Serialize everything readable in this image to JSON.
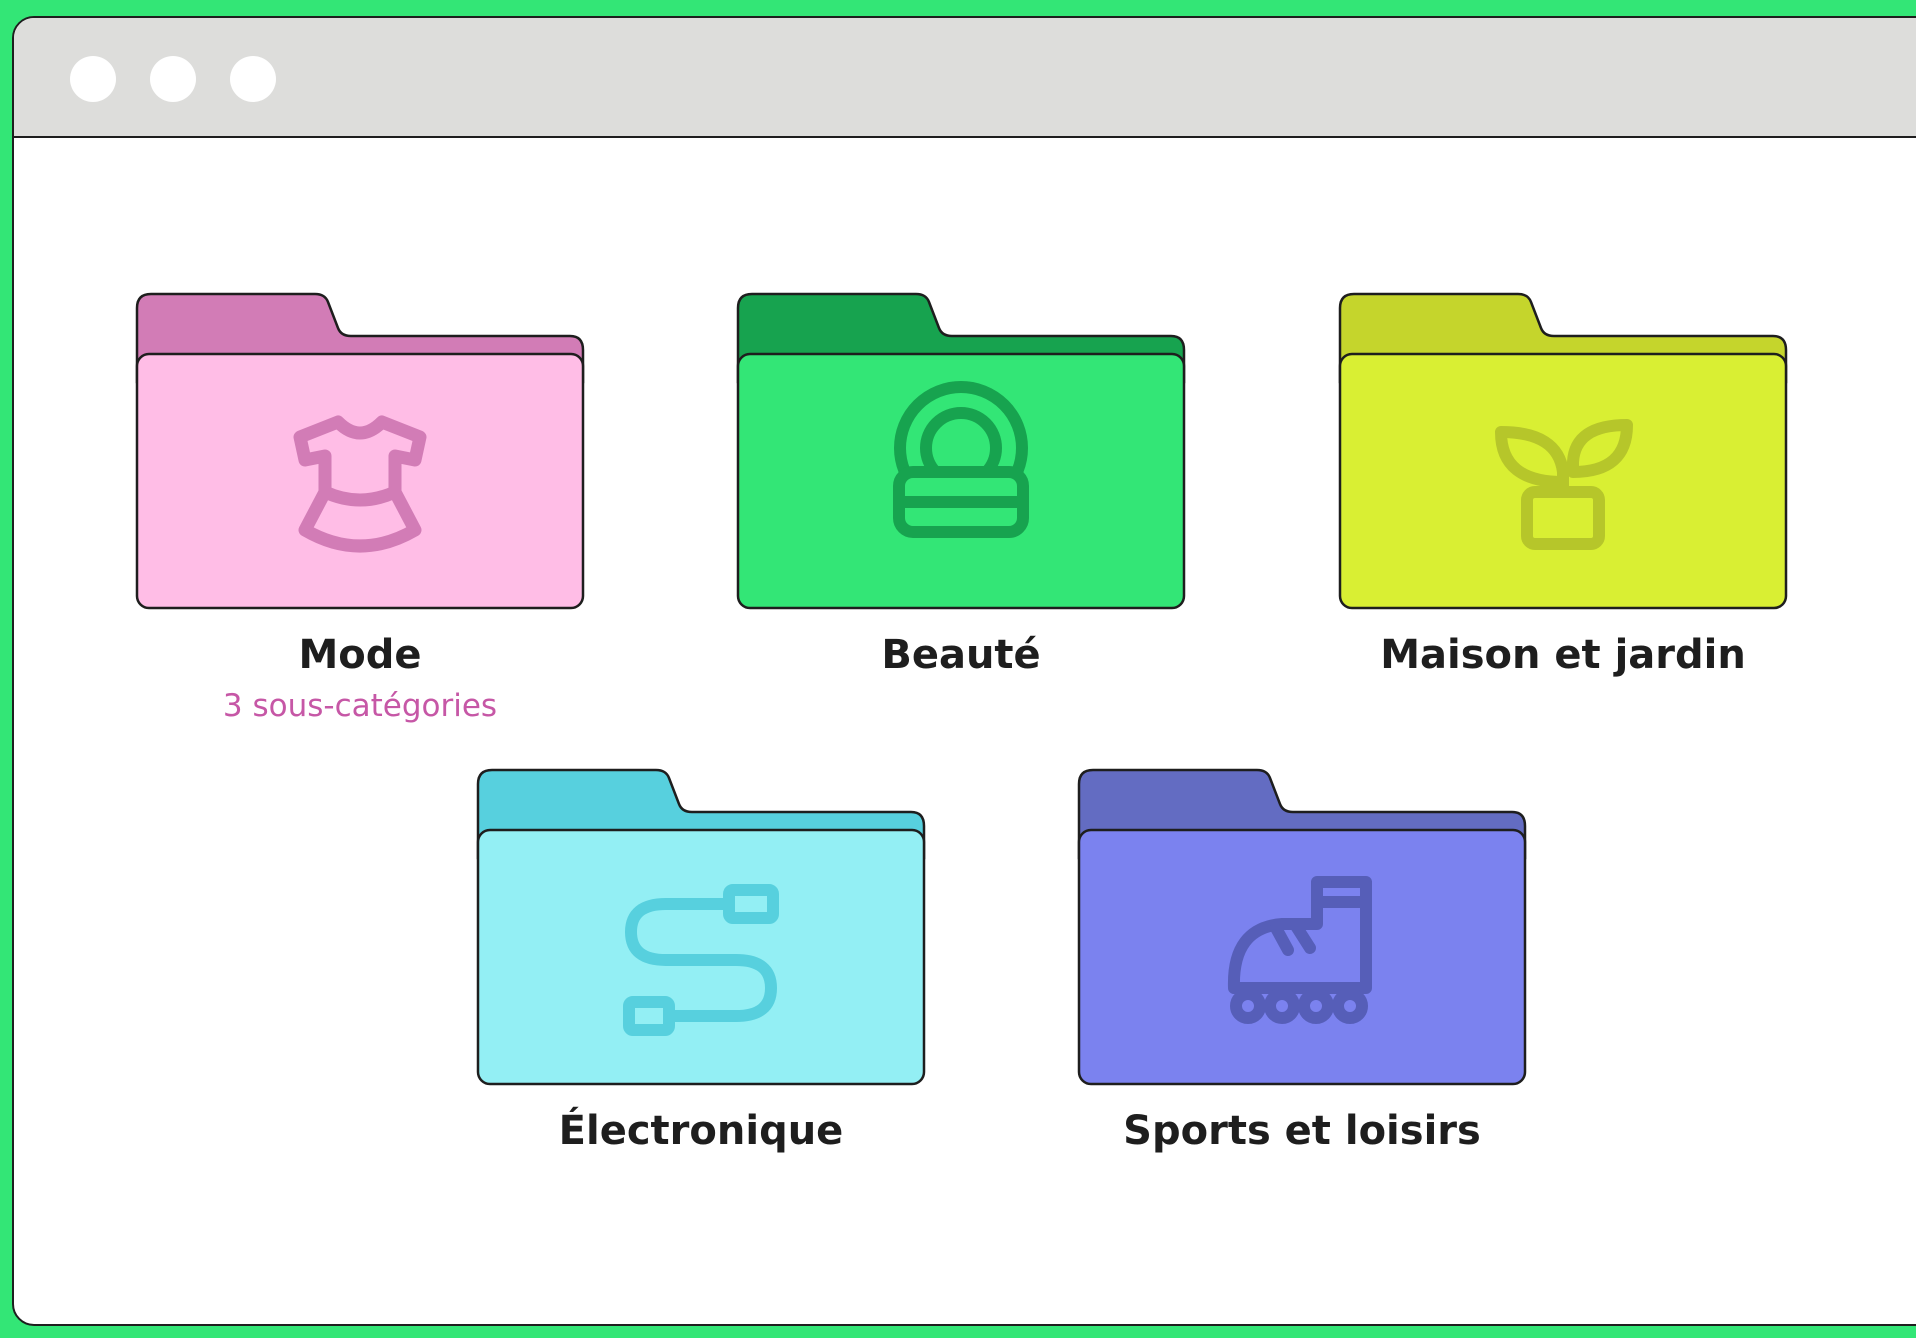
{
  "window": {
    "controls": [
      "window-control-dot",
      "window-control-dot",
      "window-control-dot"
    ]
  },
  "categories": [
    {
      "label": "Mode",
      "subtitle": "3 sous-catégories",
      "icon": "dress-icon",
      "colors": {
        "tab": "#d27cb6",
        "body": "#ffbde6",
        "icon": "#d27cb6"
      }
    },
    {
      "label": "Beauté",
      "icon": "cosmetic-jar-icon",
      "colors": {
        "tab": "#17a34f",
        "body": "#33e676",
        "icon": "#17a34f"
      }
    },
    {
      "label": "Maison et jardin",
      "icon": "potted-plant-icon",
      "colors": {
        "tab": "#c5d52c",
        "body": "#d9ef33",
        "icon": "#b6c62a"
      }
    },
    {
      "label": "Électronique",
      "icon": "cable-icon",
      "colors": {
        "tab": "#57d0de",
        "body": "#93eff4",
        "icon": "#57d0de"
      }
    },
    {
      "label": "Sports et loisirs",
      "icon": "roller-skate-icon",
      "colors": {
        "tab": "#636cc2",
        "body": "#7b82ef",
        "icon": "#565eb8"
      }
    }
  ]
}
